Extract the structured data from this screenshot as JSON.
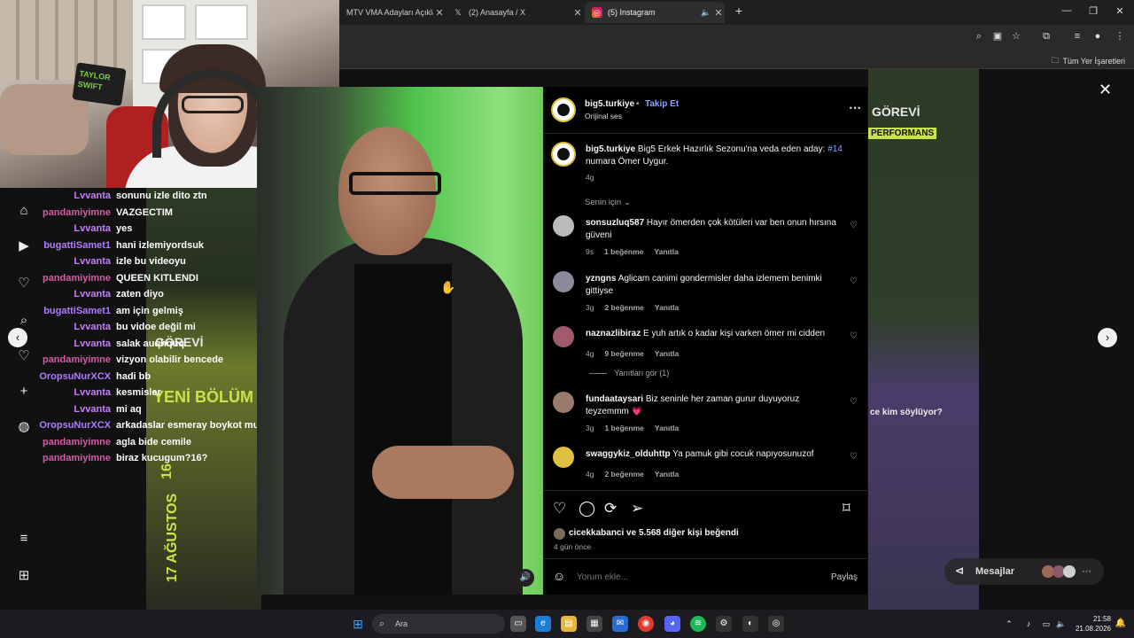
{
  "browser": {
    "tabs": [
      {
        "label": "MTV VMA Adayları Açıkla",
        "icon": "globe-icon"
      },
      {
        "label": "(2) Anasayfa / X",
        "icon": "x-logo-icon"
      },
      {
        "label": "(5) Instagram",
        "icon": "instagram-icon"
      }
    ],
    "bookmarks_all": "Tüm Yer İşaretleri"
  },
  "chat": {
    "messages": [
      {
        "user": "Lvvanta",
        "text": "sonunu izle dito ztn",
        "color": "#c77dff"
      },
      {
        "user": "pandamiyimne",
        "text": "VAZGECTIM",
        "color": "#d65aa8"
      },
      {
        "user": "Lvvanta",
        "text": "yes",
        "color": "#c77dff"
      },
      {
        "user": "bugattiSamet1",
        "text": "hani izlemiyordsuk",
        "color": "#b07cff"
      },
      {
        "user": "Lvvanta",
        "text": "izle bu videoyu",
        "color": "#c77dff"
      },
      {
        "user": "pandamiyimne",
        "text": "QUEEN KITLENDI",
        "color": "#d65aa8"
      },
      {
        "user": "Lvvanta",
        "text": "zaten diyo",
        "color": "#c77dff"
      },
      {
        "user": "bugattiSamet1",
        "text": "am için gelmiş",
        "color": "#b07cff"
      },
      {
        "user": "Lvvanta",
        "text": "bu vidoe değil mi",
        "color": "#c77dff"
      },
      {
        "user": "Lvvanta",
        "text": "salak auqhquq",
        "color": "#c77dff"
      },
      {
        "user": "pandamiyimne",
        "text": "vizyon olabilir bencede",
        "color": "#d65aa8"
      },
      {
        "user": "OropsuNurXCX",
        "text": "hadi bb",
        "color": "#b07cff"
      },
      {
        "user": "Lvvanta",
        "text": "kesmisler",
        "color": "#c77dff"
      },
      {
        "user": "Lvvanta",
        "text": "mi aq",
        "color": "#c77dff"
      },
      {
        "user": "OropsuNurXCX",
        "text": "arkadaslar esmeray boykot mu",
        "color": "#b07cff"
      },
      {
        "user": "pandamiyimne",
        "text": "agla bide cemile",
        "color": "#d65aa8"
      },
      {
        "user": "pandamiyimne",
        "text": "biraz kucugum?16?",
        "color": "#d65aa8"
      }
    ]
  },
  "background": {
    "left_texts": [
      "GÖREVİ",
      "YENİ BÖLÜM",
      "17 AĞUSTOS",
      "16"
    ],
    "right_texts": [
      "GÖREVİ",
      "PERFORMANS",
      "ce kim söylüyor?"
    ]
  },
  "post": {
    "account": "big5.turkiye",
    "follow": "Takip Et",
    "audio": "Orijinal ses",
    "caption_user": "big5.turkiye",
    "caption_text": "Big5 Erkek Hazırlık Sezonu'na veda eden aday:",
    "caption_tag": "#14",
    "caption_rest": "numara Ömer Uygur.",
    "caption_time": "4g",
    "filter": "Senin için",
    "comments": [
      {
        "user": "sonsuzluq587",
        "text": "Hayır ömerden çok kötüleri var ben onun hırsına güveni",
        "time": "9s",
        "likes": "1 beğenme",
        "reply": "Yanıtla",
        "avatar": "#bbbbbb"
      },
      {
        "user": "yzngns",
        "text": "Aglicam canimi gondermisler daha izlemem benimki gittiyse",
        "time": "3g",
        "likes": "2 beğenme",
        "reply": "Yanıtla",
        "avatar": "#8a8a9a"
      },
      {
        "user": "naznazlibiraz",
        "text": "E yuh artık o kadar kişi varken ömer mi cidden",
        "time": "4g",
        "likes": "9 beğenme",
        "reply": "Yanıtla",
        "avatar": "#a05a6a"
      },
      {
        "user": "fundaataysari",
        "text": "Biz seninle her zaman gurur duyuyoruz teyzemmm 💗",
        "time": "3g",
        "likes": "1 beğenme",
        "reply": "Yanıtla",
        "avatar": "#9a7a6a"
      },
      {
        "user": "swaggykiz_olduhttp",
        "text": "Ya pamuk gibi cocuk napıyosunuzof",
        "time": "4g",
        "likes": "2 beğenme",
        "reply": "Yanıtla",
        "avatar": "#e0c040"
      }
    ],
    "view_replies": "Yanıtları gör (1)",
    "liked_by_user": "cicekkabanci",
    "liked_by_rest": "ve 5.568 diğer kişi beğendi",
    "posted": "4 gün önce",
    "comment_placeholder": "Yorum ekle...",
    "share": "Paylaş"
  },
  "messages_label": "Mesajlar",
  "taskbar": {
    "search": "Ara",
    "time": "21:58",
    "date": "21.08.2026"
  },
  "webcam_sign": "TAYLOR SWIFT"
}
